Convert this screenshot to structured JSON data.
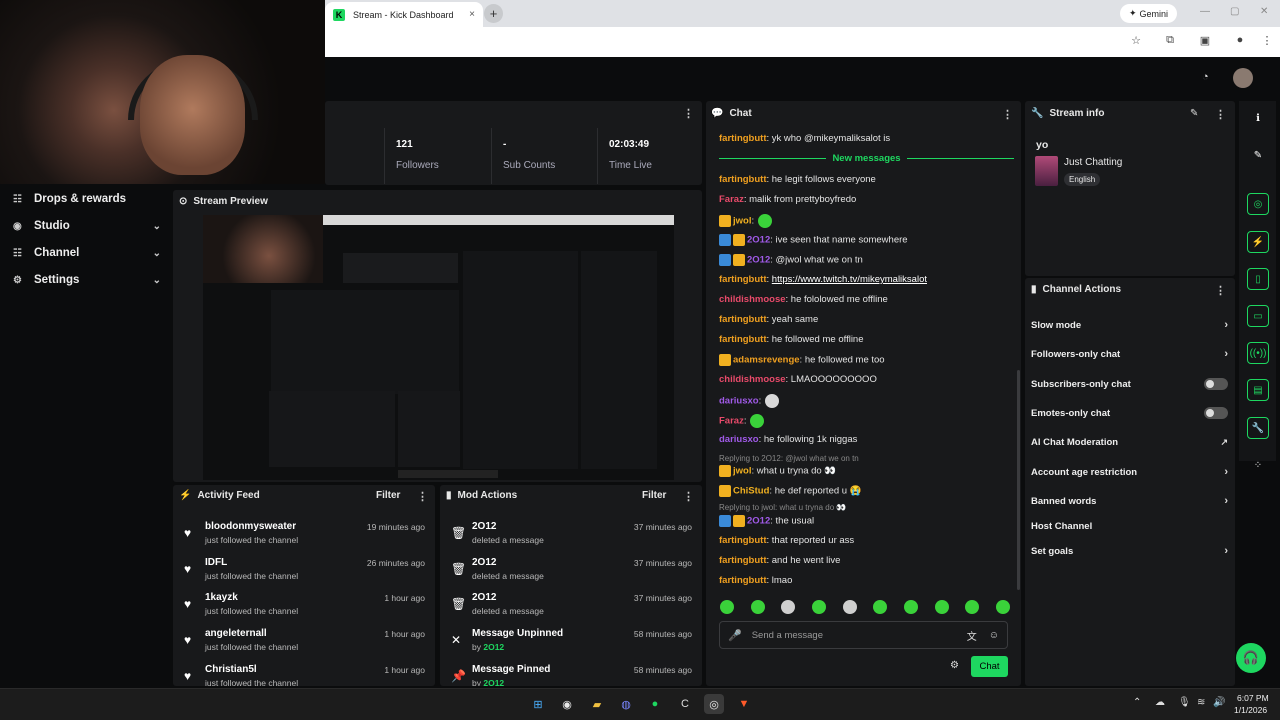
{
  "browser": {
    "tab_title": "Stream - Kick Dashboard",
    "tab_close": "×",
    "new_tab": "+",
    "gemini_label": "Gemini"
  },
  "sidebar": {
    "items": [
      {
        "label": "Drops & rewards",
        "icon": "drops-icon"
      },
      {
        "label": "Studio",
        "icon": "studio-icon"
      },
      {
        "label": "Channel",
        "icon": "channel-icon"
      },
      {
        "label": "Settings",
        "icon": "gear-icon"
      }
    ]
  },
  "stats": [
    {
      "value": "121",
      "label": "Followers"
    },
    {
      "value": "-",
      "label": "Sub Counts"
    },
    {
      "value": "02:03:49",
      "label": "Time Live"
    }
  ],
  "preview": {
    "title": "Stream Preview"
  },
  "activity": {
    "title": "Activity Feed",
    "filter": "Filter",
    "rows": [
      {
        "name": "bloodonmysweater",
        "sub": "just followed the channel",
        "time": "19 minutes ago"
      },
      {
        "name": "IDFL",
        "sub": "just followed the channel",
        "time": "26 minutes ago"
      },
      {
        "name": "1kayzk",
        "sub": "just followed the channel",
        "time": "1 hour ago"
      },
      {
        "name": "angeleternall",
        "sub": "just followed the channel",
        "time": "1 hour ago"
      },
      {
        "name": "Christian5l",
        "sub": "just followed the channel",
        "time": "1 hour ago"
      }
    ]
  },
  "mod": {
    "title": "Mod Actions",
    "filter": "Filter",
    "rows": [
      {
        "name": "2O12",
        "sub": "deleted a message",
        "time": "37 minutes ago"
      },
      {
        "name": "2O12",
        "sub": "deleted a message",
        "time": "37 minutes ago"
      },
      {
        "name": "2O12",
        "sub": "deleted a message",
        "time": "37 minutes ago"
      },
      {
        "name": "Message Unpinned",
        "sub_prefix": "by",
        "sub_user": "2O12",
        "time": "58 minutes ago"
      },
      {
        "name": "Message Pinned",
        "sub_prefix": "by",
        "sub_user": "2O12",
        "time": "58 minutes ago"
      }
    ]
  },
  "chat": {
    "title": "Chat",
    "new_messages": "New messages",
    "placeholder": "Send a message",
    "send": "Chat",
    "messages": [
      {
        "user": "fartingbutt",
        "color": "#f0a020",
        "text": ": yk who @mikeymaliksalot is"
      },
      {
        "user": "fartingbutt",
        "color": "#f0a020",
        "text": ": he legit follows everyone"
      },
      {
        "user": "Faraz",
        "color": "#e84a6a",
        "text": ": malik from prettyboyfredo"
      },
      {
        "user": "jwol",
        "color": "#f0b020",
        "text": ":"
      },
      {
        "user": "2O12",
        "color": "#a05ae8",
        "text": ": ive seen that name somewhere"
      },
      {
        "user": "2O12",
        "color": "#a05ae8",
        "text": ": @jwol what we on tn"
      },
      {
        "user": "fartingbutt",
        "color": "#f0a020",
        "text": ": ",
        "link": "https://www.twitch.tv/mikeymaliksalot"
      },
      {
        "user": "childishmoose",
        "color": "#e84a6a",
        "text": ": he fololowed me offline"
      },
      {
        "user": "fartingbutt",
        "color": "#f0a020",
        "text": ": yeah same"
      },
      {
        "user": "fartingbutt",
        "color": "#f0a020",
        "text": ": he followed me offline"
      },
      {
        "user": "adamsrevenge",
        "color": "#f0a020",
        "text": ": he followed me too"
      },
      {
        "user": "childishmoose",
        "color": "#e84a6a",
        "text": ": LMAOOOOOOOOO"
      },
      {
        "user": "dariusxo",
        "color": "#a05ae8",
        "text": ":"
      },
      {
        "user": "Faraz",
        "color": "#e84a6a",
        "text": ":"
      },
      {
        "user": "dariusxo",
        "color": "#a05ae8",
        "text": ": he following 1k niggas"
      },
      {
        "reply": "Replying to 2O12: @jwol what we on tn"
      },
      {
        "user": "jwol",
        "color": "#f0b020",
        "text": ": what u tryna do 👀"
      },
      {
        "user": "ChiStud",
        "color": "#f0b020",
        "text": ": he def reported u 😭"
      },
      {
        "reply": "Replying to jwol: what u tryna do 👀"
      },
      {
        "user": "2O12",
        "color": "#a05ae8",
        "text": ": the usual"
      },
      {
        "user": "fartingbutt",
        "color": "#f0a020",
        "text": ": that reported ur ass"
      },
      {
        "user": "fartingbutt",
        "color": "#f0a020",
        "text": ": and he went live"
      },
      {
        "user": "fartingbutt",
        "color": "#f0a020",
        "text": ": lmao"
      }
    ]
  },
  "stream_info": {
    "title": "Stream info",
    "stream_title": "yo",
    "category": "Just Chatting",
    "language": "English"
  },
  "channel_actions": {
    "title": "Channel Actions",
    "items": [
      {
        "label": "Slow mode",
        "control": "chevron"
      },
      {
        "label": "Followers-only chat",
        "control": "chevron"
      },
      {
        "label": "Subscribers-only chat",
        "control": "toggle"
      },
      {
        "label": "Emotes-only chat",
        "control": "toggle"
      },
      {
        "label": "AI Chat Moderation",
        "control": "external"
      },
      {
        "label": "Account age restriction",
        "control": "chevron"
      },
      {
        "label": "Banned words",
        "control": "chevron"
      },
      {
        "label": "Host Channel",
        "control": "none"
      },
      {
        "label": "Set goals",
        "control": "chevron"
      }
    ]
  },
  "taskbar": {
    "time": "6:07 PM",
    "date": "1/1/2026"
  },
  "colors": {
    "accent": "#1ed760",
    "panel": "#18191b",
    "background": "#0b0c0d"
  }
}
